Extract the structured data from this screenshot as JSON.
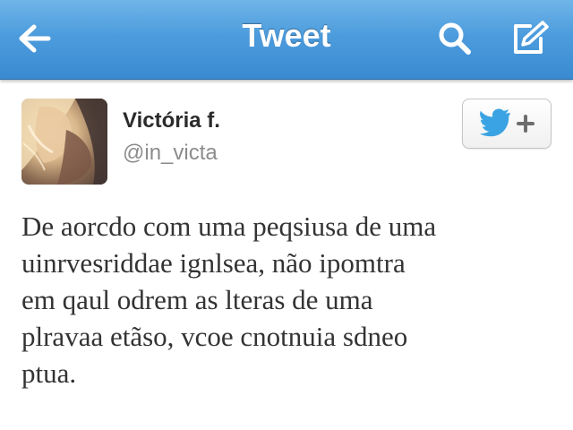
{
  "colors": {
    "navbar_top": "#6fb5e9",
    "navbar_bottom": "#3a8ad2",
    "nav_text": "#ffffff",
    "name_text": "#2b2b2b",
    "handle_text": "#8c8c8c",
    "tweet_text": "#333333",
    "twitter_blue": "#3aa3e3"
  },
  "navbar": {
    "title": "Tweet",
    "back_icon": "back-arrow-icon",
    "search_icon": "search-icon",
    "compose_icon": "compose-icon"
  },
  "author": {
    "name": "Victória f.",
    "handle": "@in_victa",
    "avatar_icon": "profile-photo",
    "follow_icon": "follow-bird-plus-icon"
  },
  "tweet": {
    "text": "De aorcdo com uma peqsiusa de uma\nuinrvesriddae ignlsea, não ipomtra\nem qaul odrem as lteras de uma\nplravaa etãso, vcoe cnotnuia sdneo\nptua."
  }
}
